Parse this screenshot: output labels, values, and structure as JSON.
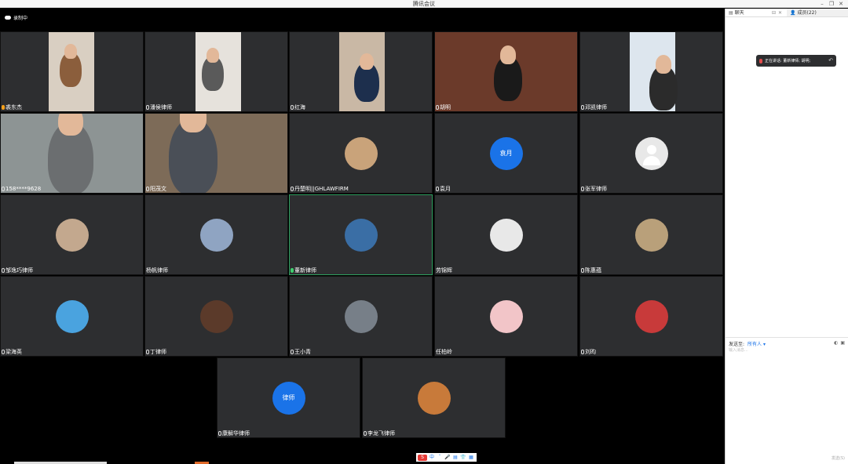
{
  "window": {
    "title": "腾讯会议",
    "minimize": "–",
    "restore": "❐",
    "close": "✕"
  },
  "recording": {
    "label": "录制中",
    "icon": "cloud-icon"
  },
  "tiles": [
    {
      "name": "裘东杰",
      "mode": "video",
      "mic": "speak"
    },
    {
      "name": "潘侯律师",
      "mode": "video",
      "mic": "off"
    },
    {
      "name": "红海",
      "mode": "video",
      "mic": "off"
    },
    {
      "name": "胡明",
      "mode": "video",
      "mic": "off"
    },
    {
      "name": "邓凯律师",
      "mode": "video",
      "mic": "off"
    },
    {
      "name": "158****9628",
      "mode": "video",
      "mic": "off"
    },
    {
      "name": "阳茂文",
      "mode": "video",
      "mic": "off"
    },
    {
      "name": "丹楚明||GHLAWFIRM",
      "mode": "avatar",
      "mic": "off"
    },
    {
      "name": "袁月",
      "mode": "text",
      "avatar_text": "袁月",
      "mic": "off"
    },
    {
      "name": "张军律师",
      "mode": "grey",
      "mic": "off"
    },
    {
      "name": "邹逸巧律师",
      "mode": "avatar",
      "mic": "off"
    },
    {
      "name": "杨帆律师",
      "mode": "avatar",
      "mic": "none"
    },
    {
      "name": "董新律师",
      "mode": "avatar",
      "mic": "on",
      "active": true
    },
    {
      "name": "劳锦辉",
      "mode": "avatar",
      "mic": "none"
    },
    {
      "name": "陈惠蕴",
      "mode": "avatar",
      "mic": "off"
    },
    {
      "name": "梁海英",
      "mode": "avatar",
      "mic": "off"
    },
    {
      "name": "丁律师",
      "mode": "avatar",
      "mic": "off"
    },
    {
      "name": "王小青",
      "mode": "avatar",
      "mic": "off"
    },
    {
      "name": "任柏岭",
      "mode": "avatar",
      "mic": "none"
    },
    {
      "name": "刘昀",
      "mode": "avatar",
      "mic": "off"
    },
    {
      "name": "康解华律师",
      "mode": "text",
      "avatar_text": "律师",
      "mic": "off"
    },
    {
      "name": "李龙飞律师",
      "mode": "avatar",
      "mic": "off"
    }
  ],
  "toolbar": {
    "items": [
      "S",
      "中",
      "ˇ",
      "🎤",
      "▤",
      "👕",
      "▦"
    ]
  },
  "sidebar": {
    "tabs": [
      {
        "label": "聊天",
        "icon": "chat-icon"
      },
      {
        "label": "成员(22)",
        "icon": "members-icon"
      }
    ],
    "tab_controls": [
      "⊟",
      "✕"
    ],
    "notice": {
      "text": "正在讲话: 董新律师; 胡明;",
      "icon": "mic-icon",
      "return_icon": "↶"
    },
    "send_to_label": "发送至:",
    "send_to_value": "所有人 ▾",
    "input_placeholder": "输入消息...",
    "send_label": "发送(S)",
    "icons": [
      "◐",
      "▣"
    ]
  },
  "colors": {
    "accent": "#1a73e8",
    "tile_bg": "#2d2e30",
    "active_border": "#2e9e5e"
  }
}
